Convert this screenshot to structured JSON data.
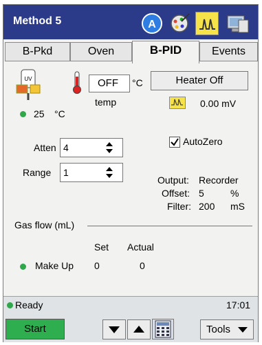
{
  "window": {
    "title": "Method 5"
  },
  "titlebar_icons": [
    "a-circle-icon",
    "gear-icon",
    "signal-icon",
    "computer-icon"
  ],
  "tabs": [
    {
      "label": "B-Pkd",
      "active": false
    },
    {
      "label": "Oven",
      "active": false
    },
    {
      "label": "B-PID",
      "active": true
    },
    {
      "label": "Events",
      "active": false
    }
  ],
  "detector": {
    "temp_value": "OFF",
    "temp_unit": "°C",
    "temp_label": "temp",
    "current_temp": "25",
    "current_temp_unit": "°C",
    "heater_button": "Heater Off",
    "signal_value": "0.00 mV"
  },
  "settings": {
    "atten_label": "Atten",
    "atten_value": "4",
    "range_label": "Range",
    "range_value": "1",
    "autozero_label": "AutoZero",
    "autozero_checked": true
  },
  "output": {
    "output_label": "Output:",
    "output_value": "Recorder",
    "offset_label": "Offset:",
    "offset_value": "5",
    "offset_unit": "%",
    "filter_label": "Filter:",
    "filter_value": "200",
    "filter_unit": "mS"
  },
  "gasflow": {
    "section_label": "Gas flow (mL)",
    "set_header": "Set",
    "actual_header": "Actual",
    "rows": [
      {
        "label": "Make Up",
        "set": "0",
        "actual": "0"
      }
    ]
  },
  "status": {
    "text": "Ready",
    "time": "17:01"
  },
  "bottombar": {
    "start_label": "Start",
    "tools_label": "Tools"
  },
  "colors": {
    "title_bg": "#2c3a8a",
    "start_bg": "#2fae4f",
    "status_dot": "#2ea84b"
  }
}
